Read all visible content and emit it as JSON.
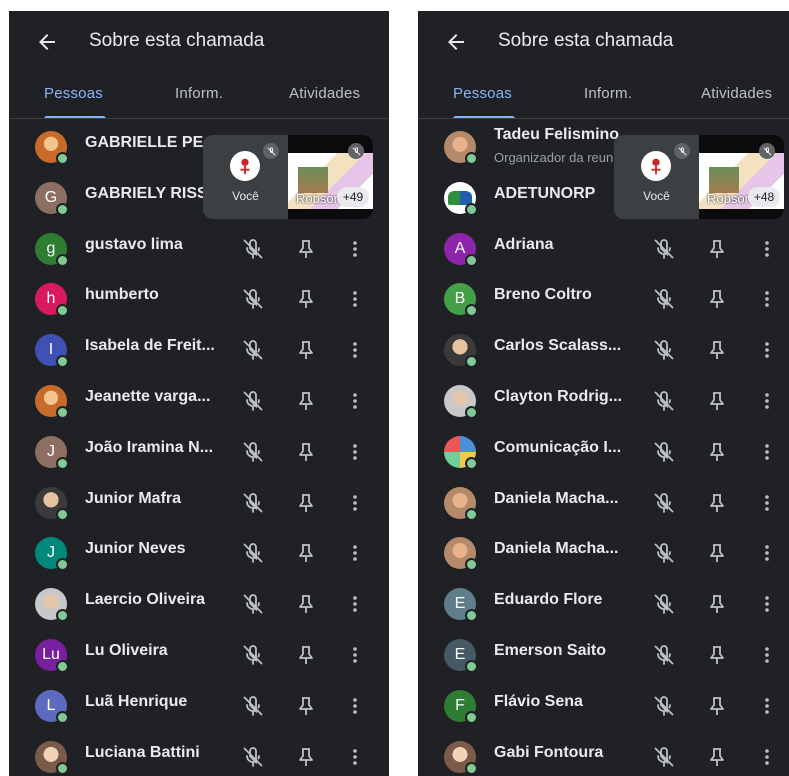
{
  "header": {
    "title": "Sobre esta chamada"
  },
  "tabs": [
    "Pessoas",
    "Inform.",
    "Atividades"
  ],
  "left": {
    "tile": {
      "you_label": "Você",
      "other_label": "Robson",
      "count": "+49"
    },
    "people": [
      {
        "name": "GABRIELLE PE...",
        "initial": "",
        "color": "",
        "photo": "p3",
        "controls": false
      },
      {
        "name": "GABRIELY RISS...",
        "initial": "G",
        "color": "#8d6e63",
        "controls": false
      },
      {
        "name": "gustavo lima",
        "initial": "g",
        "color": "#2e7d32",
        "controls": true
      },
      {
        "name": "humberto",
        "initial": "h",
        "color": "#d81b60",
        "controls": true
      },
      {
        "name": "Isabela de Freit...",
        "initial": "I",
        "color": "#3f51b5",
        "controls": true
      },
      {
        "name": "Jeanette varga...",
        "initial": "",
        "color": "",
        "photo": "p3",
        "controls": true
      },
      {
        "name": "João Iramina N...",
        "initial": "J",
        "color": "#8d6e63",
        "controls": true
      },
      {
        "name": "Junior Mafra",
        "initial": "",
        "color": "",
        "photo": "p2",
        "controls": true
      },
      {
        "name": "Junior Neves",
        "initial": "J",
        "color": "#00897b",
        "controls": true
      },
      {
        "name": "Laercio Oliveira",
        "initial": "",
        "color": "",
        "photo": "p4",
        "controls": true
      },
      {
        "name": "Lu Oliveira",
        "initial": "Lu",
        "color": "#7b1fa2",
        "controls": true
      },
      {
        "name": "Luã Henrique",
        "initial": "L",
        "color": "#5c6bc0",
        "controls": true
      },
      {
        "name": "Luciana Battini",
        "initial": "",
        "color": "",
        "photo": "p5",
        "controls": true
      }
    ]
  },
  "right": {
    "tile": {
      "you_label": "Você",
      "other_label": "Robson",
      "count": "+48"
    },
    "people": [
      {
        "name": "Tadeu Felismino",
        "sub": "Organizador da reunião",
        "initial": "",
        "color": "",
        "photo": "p6",
        "controls": false
      },
      {
        "name": "ADETUNORP",
        "initial": "",
        "color": "",
        "photo": "logo",
        "controls": false
      },
      {
        "name": "Adriana",
        "initial": "A",
        "color": "#8e24aa",
        "controls": true
      },
      {
        "name": "Breno Coltro",
        "initial": "B",
        "color": "#43a047",
        "controls": true
      },
      {
        "name": "Carlos Scalass...",
        "initial": "",
        "color": "",
        "photo": "p2",
        "controls": true
      },
      {
        "name": "Clayton Rodrig...",
        "initial": "",
        "color": "",
        "photo": "p4",
        "controls": true
      },
      {
        "name": "Comunicação I...",
        "initial": "",
        "color": "",
        "photo": "collage",
        "controls": true
      },
      {
        "name": "Daniela Macha...",
        "initial": "",
        "color": "",
        "photo": "p6",
        "controls": true
      },
      {
        "name": "Daniela Macha...",
        "initial": "",
        "color": "",
        "photo": "p6",
        "controls": true
      },
      {
        "name": "Eduardo Flore",
        "initial": "E",
        "color": "#607d8b",
        "controls": true
      },
      {
        "name": "Emerson Saito",
        "initial": "E",
        "color": "#455a64",
        "controls": true
      },
      {
        "name": "Flávio Sena",
        "initial": "F",
        "color": "#2e7d32",
        "controls": true
      },
      {
        "name": "Gabi Fontoura",
        "initial": "",
        "color": "",
        "photo": "p5",
        "controls": true
      }
    ]
  },
  "icons": {
    "mic_off": "mic-off-icon",
    "pin": "pin-icon",
    "more": "more-vert-icon",
    "back": "arrow-back-icon"
  },
  "colors": {
    "background": "#202124",
    "accent": "#8ab4f8",
    "online": "#81c995"
  }
}
